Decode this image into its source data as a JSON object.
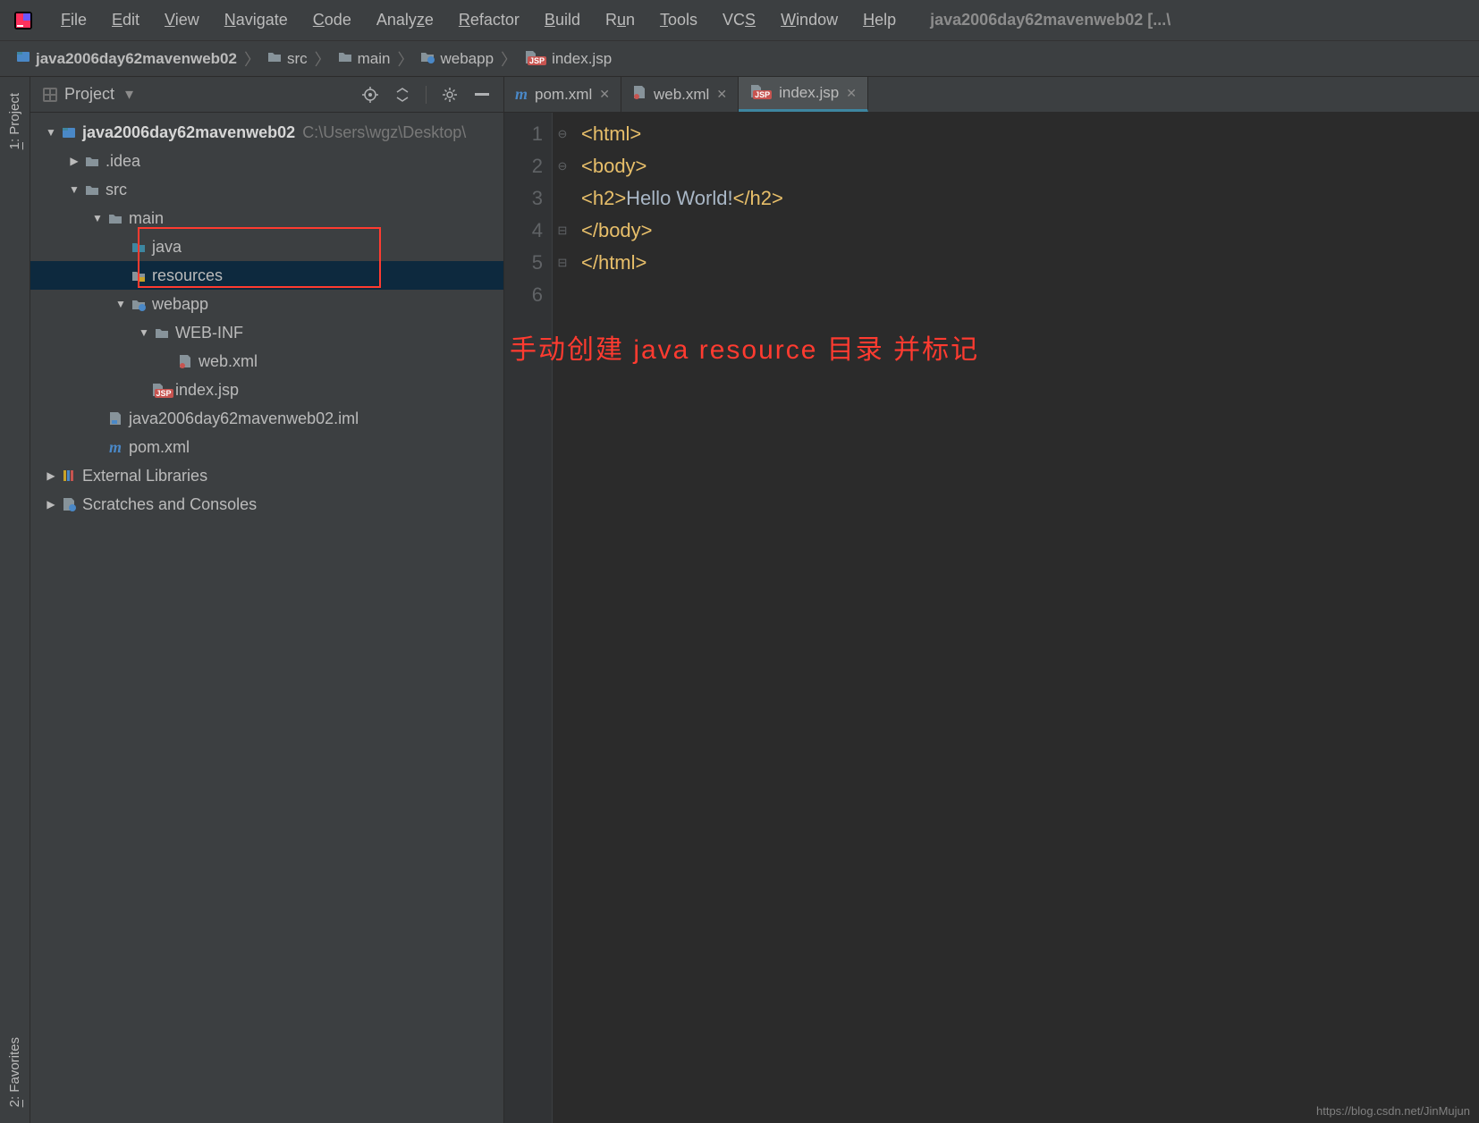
{
  "menubar": {
    "items": [
      "File",
      "Edit",
      "View",
      "Navigate",
      "Code",
      "Analyze",
      "Refactor",
      "Build",
      "Run",
      "Tools",
      "VCS",
      "Window",
      "Help"
    ],
    "mnemonics": [
      "F",
      "E",
      "V",
      "N",
      "C",
      "z",
      "R",
      "B",
      "u",
      "T",
      "S",
      "W",
      "H"
    ]
  },
  "window_title": "java2006day62mavenweb02 [...\\",
  "breadcrumb": [
    {
      "icon": "module",
      "label": "java2006day62mavenweb02"
    },
    {
      "icon": "folder",
      "label": "src"
    },
    {
      "icon": "folder",
      "label": "main"
    },
    {
      "icon": "web",
      "label": "webapp"
    },
    {
      "icon": "jsp",
      "label": "index.jsp"
    }
  ],
  "left_gutter": {
    "top": "1: Project",
    "bottom": "2: Favorites"
  },
  "toolwindow": {
    "title": "Project"
  },
  "tree": [
    {
      "indent": 0,
      "arrow": "down",
      "icon": "module",
      "label": "java2006day62mavenweb02",
      "bold": true,
      "sub": "C:\\Users\\wgz\\Desktop\\",
      "sel": false
    },
    {
      "indent": 1,
      "arrow": "right",
      "icon": "folder",
      "label": ".idea",
      "sel": false
    },
    {
      "indent": 1,
      "arrow": "down",
      "icon": "folder",
      "label": "src",
      "sel": false
    },
    {
      "indent": 2,
      "arrow": "down",
      "icon": "folder",
      "label": "main",
      "sel": false
    },
    {
      "indent": 3,
      "arrow": "",
      "icon": "src-folder",
      "label": "java",
      "sel": false
    },
    {
      "indent": 3,
      "arrow": "",
      "icon": "res-folder",
      "label": "resources",
      "sel": true
    },
    {
      "indent": 3,
      "arrow": "down",
      "icon": "web-folder",
      "label": "webapp",
      "sel": false
    },
    {
      "indent": 4,
      "arrow": "down",
      "icon": "folder",
      "label": "WEB-INF",
      "sel": false
    },
    {
      "indent": 5,
      "arrow": "",
      "icon": "xml",
      "label": "web.xml",
      "sel": false
    },
    {
      "indent": 4,
      "arrow": "",
      "icon": "jsp",
      "label": "index.jsp",
      "sel": false
    },
    {
      "indent": 2,
      "arrow": "",
      "icon": "iml",
      "label": "java2006day62mavenweb02.iml",
      "sel": false
    },
    {
      "indent": 2,
      "arrow": "",
      "icon": "maven",
      "label": "pom.xml",
      "sel": false
    },
    {
      "indent": 0,
      "arrow": "right",
      "icon": "lib",
      "label": "External Libraries",
      "sel": false
    },
    {
      "indent": 0,
      "arrow": "right",
      "icon": "scratch",
      "label": "Scratches and Consoles",
      "sel": false
    }
  ],
  "tabs": [
    {
      "icon": "maven",
      "label": "pom.xml",
      "active": false
    },
    {
      "icon": "xml",
      "label": "web.xml",
      "active": false
    },
    {
      "icon": "jsp",
      "label": "index.jsp",
      "active": true
    }
  ],
  "editor": {
    "lines": [
      "1",
      "2",
      "3",
      "4",
      "5",
      "6"
    ],
    "fold": [
      "⊖",
      "⊖",
      "",
      "⊟",
      "⊟",
      ""
    ],
    "code": [
      [
        {
          "c": "tag",
          "t": "<html>"
        }
      ],
      [
        {
          "c": "tag",
          "t": "<body>"
        }
      ],
      [
        {
          "c": "tag",
          "t": "<h2>"
        },
        {
          "c": "txt",
          "t": "Hello World!"
        },
        {
          "c": "tag",
          "t": "</h2>"
        }
      ],
      [
        {
          "c": "tag",
          "t": "</body>"
        }
      ],
      [
        {
          "c": "tag",
          "t": "</html>"
        }
      ],
      []
    ]
  },
  "annotation": "手动创建  java  resource 目录 并标记",
  "watermark": "https://blog.csdn.net/JinMujun"
}
